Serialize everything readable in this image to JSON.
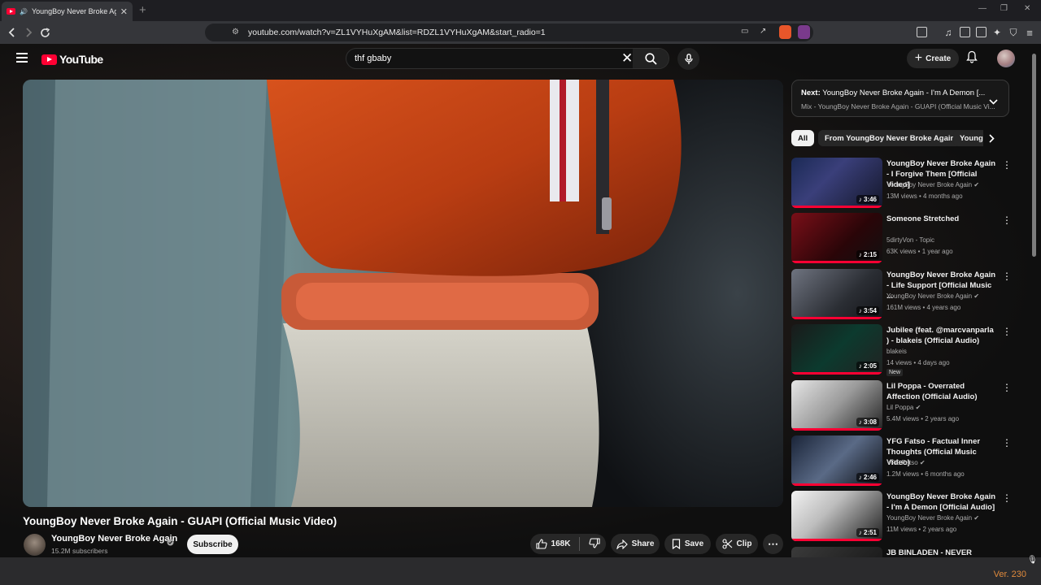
{
  "browser": {
    "tab_title": "YoungBoy Never Broke Again",
    "url": "youtube.com/watch?v=ZL1VYHuXgAM&list=RDZL1VYHuXgAM&start_radio=1"
  },
  "youtube": {
    "logo_text": "YouTube",
    "search_query": "thf gbaby",
    "create_label": "Create",
    "video": {
      "title": "YoungBoy Never Broke Again - GUAPI (Official Music Video)",
      "channel": "YoungBoy Never Broke Again",
      "subscribers": "15.2M subscribers",
      "subscribe_label": "Subscribe",
      "likes": "168K",
      "share_label": "Share",
      "save_label": "Save",
      "clip_label": "Clip"
    },
    "next": {
      "prefix": "Next:",
      "title": "YoungBoy Never Broke Again - I'm A Demon [...",
      "subtitle": "Mix - YoungBoy Never Broke Again - GUAPI (Official Music Vi..."
    },
    "chips": [
      "All",
      "From YoungBoy Never Broke Again",
      "Young"
    ],
    "recommendations": [
      {
        "title": "YoungBoy Never Broke Again - I Forgive Them [Official Video]",
        "channel": "YoungBoy Never Broke Again",
        "verified": true,
        "meta": "13M views • 4 months ago",
        "duration": "3:46"
      },
      {
        "title": "Someone Stretched",
        "channel": "5dirtyVon - Topic",
        "verified": false,
        "meta": "63K views • 1 year ago",
        "duration": "2:15"
      },
      {
        "title": "YoungBoy Never Broke Again - Life Support [Official Music ...",
        "channel": "YoungBoy Never Broke Again",
        "verified": true,
        "meta": "161M views • 4 years ago",
        "duration": "3:54"
      },
      {
        "title": "Jubilee (feat. @marcvanparla ) - blakeis (Official Audio)",
        "channel": "blakeis",
        "verified": false,
        "meta": "14 views • 4 days ago",
        "duration": "2:05",
        "badge": "New"
      },
      {
        "title": "Lil Poppa - Overrated Affection (Official Audio)",
        "channel": "Lil Poppa",
        "verified": true,
        "meta": "5.4M views • 2 years ago",
        "duration": "3:08"
      },
      {
        "title": "YFG Fatso - Factual Inner Thoughts (Official Music Video)",
        "channel": "YFG Fatso",
        "verified": true,
        "meta": "1.2M views • 6 months ago",
        "duration": "2:46"
      },
      {
        "title": "YoungBoy Never Broke Again - I'm A Demon [Official Audio]",
        "channel": "YoungBoy Never Broke Again",
        "verified": true,
        "meta": "11M views • 2 years ago",
        "duration": "2:51"
      },
      {
        "title": "JB BINLADEN - NEVER"
      }
    ]
  },
  "footer": {
    "version": "Ver. 230"
  },
  "colors": {
    "accent_red": "#ff0033",
    "background": "#0f0f0f",
    "chip_active": "#f1f1f1"
  }
}
